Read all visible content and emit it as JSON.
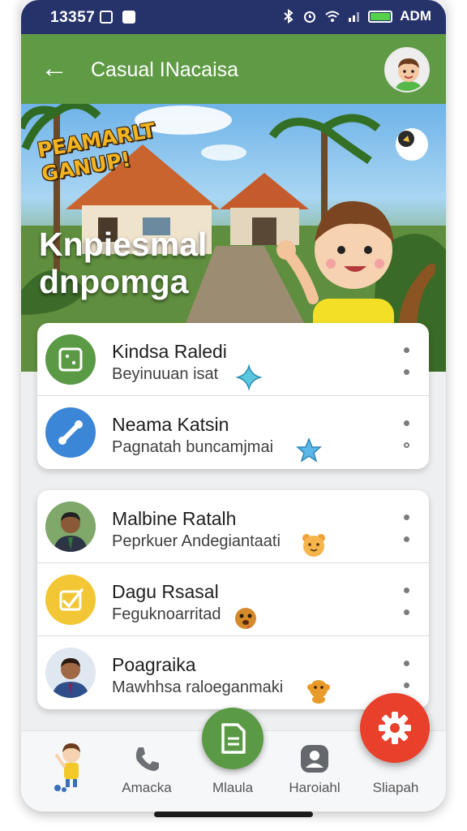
{
  "status_bar": {
    "time": "13357",
    "right_text": "ADM"
  },
  "app_bar": {
    "title": "Casual INacaisa"
  },
  "hero": {
    "logo_text_line1": "PEAMARLT",
    "logo_text_line2": "GANUP!",
    "title_line1": "Knpiesmal",
    "title_line2": "dnpomga"
  },
  "card1": {
    "rows": [
      {
        "title": "Kindsa Raledi",
        "subtitle": "Beyinuuan isat",
        "icon": "dice-icon",
        "accent": "#5a9a45"
      },
      {
        "title": "Neama Katsin",
        "subtitle": "Pagnatah buncamjmai",
        "icon": "wrench-icon",
        "accent": "#3b86d6"
      }
    ]
  },
  "card2": {
    "rows": [
      {
        "title": "Malbine Ratalh",
        "subtitle": "Peprkuer Andegiantaati",
        "icon": "person-avatar"
      },
      {
        "title": "Dagu Rsasal",
        "subtitle": "Feguknoarritad",
        "icon": "checkmark-icon",
        "accent": "#f2c634"
      },
      {
        "title": "Poagraika",
        "subtitle": "Mawhhsa raloeganmaki",
        "icon": "person-avatar"
      }
    ]
  },
  "bottom_nav": {
    "items": [
      {
        "label": ""
      },
      {
        "label": "Amacka"
      },
      {
        "label": "Mlaula"
      },
      {
        "label": "Haroiahl"
      },
      {
        "label": "Sliapah"
      }
    ]
  },
  "colors": {
    "status_bar": "#26336b",
    "app_bar": "#5f9a45",
    "fab_green": "#5a9a45",
    "fab_red": "#e8402a"
  }
}
